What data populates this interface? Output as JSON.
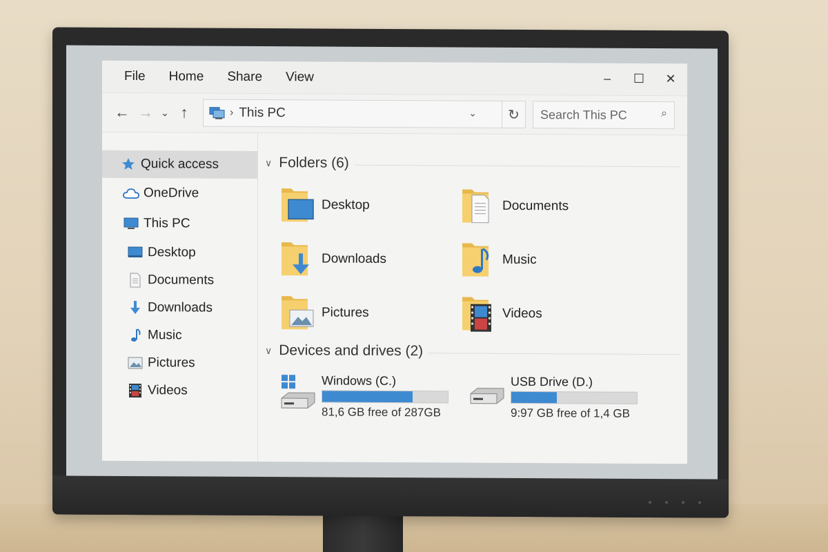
{
  "menu": {
    "items": [
      "File",
      "Home",
      "Share",
      "View"
    ]
  },
  "window_controls": {
    "minimize": "–",
    "maximize": "☐",
    "close": "✕"
  },
  "nav": {
    "back": "←",
    "forward": "→",
    "recent": "⌄",
    "up": "↑",
    "breadcrumb": "This PC",
    "breadcrumb_sep": "›",
    "address_dropdown": "⌄",
    "refresh": "↻"
  },
  "search": {
    "placeholder": "Search This PC",
    "icon": "⌕"
  },
  "sidebar": {
    "items": [
      {
        "label": "Quick access",
        "icon": "star-icon",
        "active": true
      },
      {
        "label": "OneDrive",
        "icon": "cloud-icon"
      },
      {
        "label": "This PC",
        "icon": "computer-icon"
      },
      {
        "label": "Desktop",
        "icon": "desktop-icon"
      },
      {
        "label": "Documents",
        "icon": "document-icon"
      },
      {
        "label": "Downloads",
        "icon": "download-icon"
      },
      {
        "label": "Music",
        "icon": "music-icon"
      },
      {
        "label": "Pictures",
        "icon": "pictures-icon"
      },
      {
        "label": "Videos",
        "icon": "videos-icon"
      }
    ]
  },
  "folders_group": {
    "title": "Folders (6)",
    "items": [
      {
        "label": "Desktop",
        "icon": "desktop-folder-icon"
      },
      {
        "label": "Documents",
        "icon": "documents-folder-icon"
      },
      {
        "label": "Downloads",
        "icon": "downloads-folder-icon"
      },
      {
        "label": "Music",
        "icon": "music-folder-icon"
      },
      {
        "label": "Pictures",
        "icon": "pictures-folder-icon"
      },
      {
        "label": "Videos",
        "icon": "videos-folder-icon"
      }
    ]
  },
  "drives_group": {
    "title": "Devices and drives (2)",
    "items": [
      {
        "name": "Windows (C.)",
        "free": "81,6 GB free of 287GB",
        "used_fraction": 0.72,
        "icon": "windows-drive-icon"
      },
      {
        "name": "USB Drive (D.)",
        "free": "9:97 GB free of 1,4 GB",
        "used_fraction": 0.36,
        "icon": "usb-drive-icon"
      }
    ]
  },
  "colors": {
    "accent": "#3e8ad1",
    "folder_yellow": "#f2c75c",
    "bezel": "#2a2a2a"
  }
}
